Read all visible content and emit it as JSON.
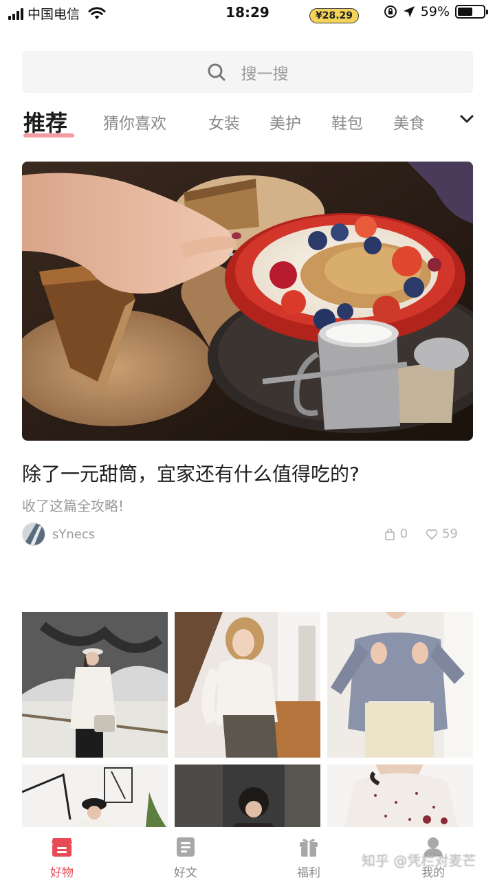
{
  "status_bar": {
    "carrier": "中国电信",
    "time": "18:29",
    "battery_percent": "59%",
    "battery_level": 0.59
  },
  "search": {
    "placeholder": "搜一搜"
  },
  "tabs": [
    {
      "label": "推荐",
      "active": true
    },
    {
      "label": "猜你喜欢",
      "active": false
    },
    {
      "label": "女装",
      "active": false
    },
    {
      "label": "美护",
      "active": false
    },
    {
      "label": "鞋包",
      "active": false
    },
    {
      "label": "美食",
      "active": false
    }
  ],
  "feature": {
    "title": "除了一元甜筒，宜家还有什么值得吃的?",
    "subtitle": "收了这篇全攻略!",
    "author": "sYnecs",
    "bag_count": "0",
    "like_count": "59"
  },
  "bottom_nav": [
    {
      "label": "好物",
      "icon": "shop-icon",
      "active": true
    },
    {
      "label": "好文",
      "icon": "article-icon",
      "active": false
    },
    {
      "label": "福利",
      "icon": "gift-icon",
      "active": false
    },
    {
      "label": "我的",
      "icon": "profile-icon",
      "active": false
    }
  ],
  "welfare_badge": "¥28.29",
  "watermark": "知乎 @凭栏对麦芒",
  "colors": {
    "accent": "#e84b55",
    "tab_underline": "#f08a8f",
    "badge": "#f4d35a"
  }
}
